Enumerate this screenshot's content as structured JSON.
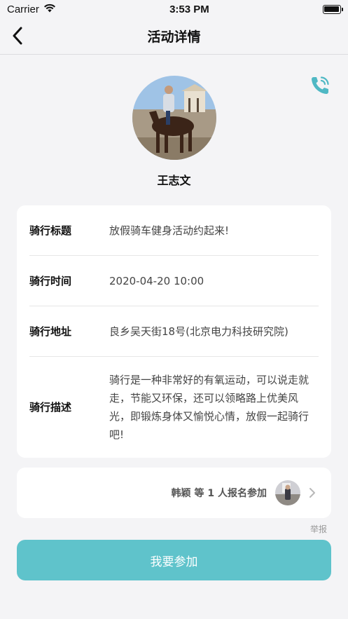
{
  "status_bar": {
    "carrier": "Carrier",
    "time": "3:53 PM"
  },
  "nav": {
    "title": "活动详情",
    "back_icon": "chevron-left-icon"
  },
  "profile": {
    "name": "王志文",
    "phone_icon": "phone-icon",
    "accent_color": "#4fb8c4"
  },
  "details": [
    {
      "label": "骑行标题",
      "value": "放假骑车健身活动约起来!"
    },
    {
      "label": "骑行时间",
      "value": "2020-04-20 10:00"
    },
    {
      "label": "骑行地址",
      "value": "良乡吴天街18号(北京电力科技研究院)"
    },
    {
      "label": "骑行描述",
      "value": "骑行是一种非常好的有氧运动，可以说走就走，节能又环保，还可以领略路上优美风光，即锻炼身体又愉悦心情，放假一起骑行吧!"
    }
  ],
  "participants": {
    "text": "韩颖 等 1 人报名参加",
    "chevron_icon": "chevron-right-icon"
  },
  "report_label": "举报",
  "join_button_label": "我要参加",
  "colors": {
    "primary_button": "#5fc3cb",
    "background": "#f4f4f6"
  }
}
